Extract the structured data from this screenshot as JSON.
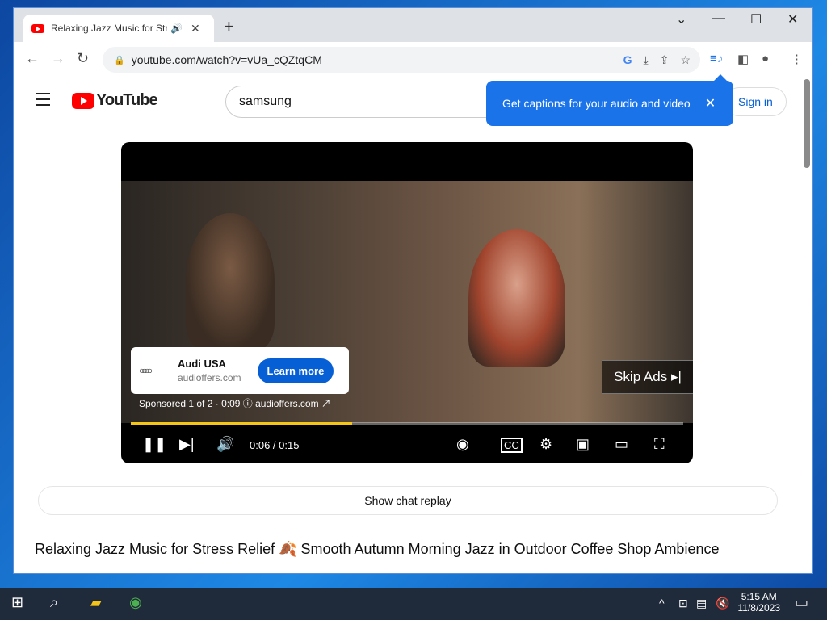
{
  "browser": {
    "tab_title": "Relaxing Jazz Music for Stre",
    "url": "youtube.com/watch?v=vUa_cQZtqCM",
    "new_tab": "+",
    "tab_close": "✕",
    "tab_audio": "🔊"
  },
  "youtube": {
    "logo_text": "YouTube",
    "search_value": "samsung",
    "sign_in": "Sign in",
    "popup_text": "Get captions for your audio and video",
    "popup_close": "✕"
  },
  "ad": {
    "advertiser": "Audi USA",
    "url": "audioffers.com",
    "learn_more": "Learn more",
    "sponsored": "Sponsored 1 of 2 · 0:09 ⓘ  audioffers.com ↗",
    "skip": "Skip Ads ▸|"
  },
  "player": {
    "time": "0:06 / 0:15",
    "progress": 0.4
  },
  "page": {
    "chat_replay": "Show chat replay",
    "video_title": "Relaxing Jazz Music for Stress Relief 🍂 Smooth Autumn Morning Jazz in Outdoor Coffee Shop Ambience"
  },
  "taskbar": {
    "time": "5:15 AM",
    "date": "11/8/2023"
  }
}
